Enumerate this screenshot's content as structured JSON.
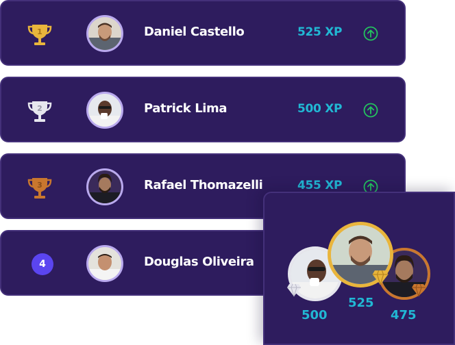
{
  "leaderboard": [
    {
      "rank": "1",
      "name": "Daniel Castello",
      "xp": "525 XP",
      "trophy_color": "#e9b53c",
      "trend": "arrow-up"
    },
    {
      "rank": "2",
      "name": "Patrick Lima",
      "xp": "500 XP",
      "trophy_color": "#e6e6ee",
      "trend": "arrow-up"
    },
    {
      "rank": "3",
      "name": "Rafael Thomazelli",
      "xp": "455 XP",
      "trophy_color": "#c9772e",
      "trend": "arrow-up"
    },
    {
      "rank": "4",
      "name": "Douglas Oliveira",
      "xp": "",
      "trophy_color": "",
      "trend": ""
    }
  ],
  "podium": {
    "first": {
      "score": "525",
      "ring_color": "#e9b53c"
    },
    "second": {
      "score": "500",
      "ring_color": "#e6e6ee"
    },
    "third": {
      "score": "475",
      "ring_color": "#c9772e"
    }
  },
  "colors": {
    "card_bg": "#2e1c5e",
    "card_border": "#44307a",
    "xp_text": "#21b8d4",
    "trend_up": "#23c55e",
    "rank_badge": "#5b45f0"
  }
}
